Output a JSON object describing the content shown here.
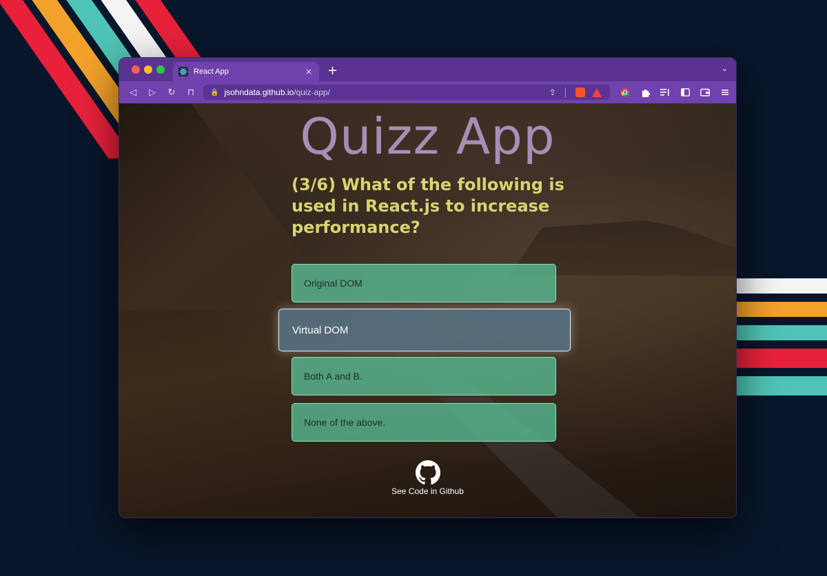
{
  "browser": {
    "tab_title": "React App",
    "tab_close": "×",
    "new_tab": "+",
    "tab_menu": "⌄",
    "url_domain": "jsohndata.github.io",
    "url_path": "/quiz-app/",
    "nav": {
      "back": "◁",
      "forward": "▷",
      "reload": "↻",
      "bookmark": "⊓"
    }
  },
  "quiz": {
    "title": "Quizz App",
    "question": "(3/6) What of the following is used in React.js to increase performance?",
    "answers": [
      {
        "label": "Original DOM",
        "selected": false
      },
      {
        "label": "Virtual DOM",
        "selected": true
      },
      {
        "label": "Both A and B.",
        "selected": false
      },
      {
        "label": "None of the above.",
        "selected": false
      }
    ],
    "github_label": "See Code in Github"
  },
  "colors": {
    "titlebar": "#5a3391",
    "toolbar": "#7042ad",
    "answer_bg": "#59be96",
    "question_text": "#d8d372",
    "title_text": "#a58fb6"
  }
}
